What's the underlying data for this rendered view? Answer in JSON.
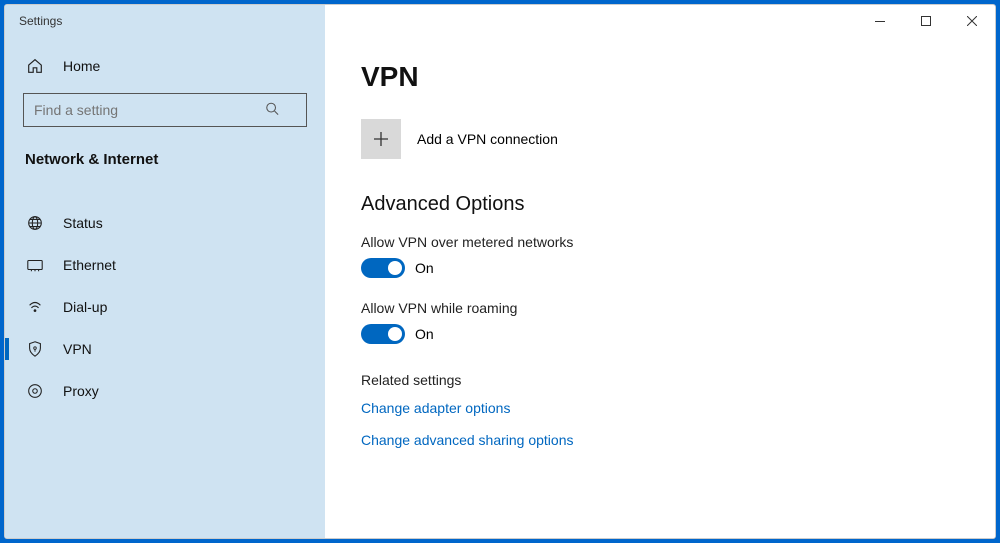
{
  "window": {
    "title": "Settings"
  },
  "sidebar": {
    "home_label": "Home",
    "search_placeholder": "Find a setting",
    "category_label": "Network & Internet",
    "items": [
      {
        "label": "Status"
      },
      {
        "label": "Ethernet"
      },
      {
        "label": "Dial-up"
      },
      {
        "label": "VPN"
      },
      {
        "label": "Proxy"
      }
    ]
  },
  "main": {
    "title": "VPN",
    "add_label": "Add a VPN connection",
    "advanced_title": "Advanced Options",
    "settings": [
      {
        "label": "Allow VPN over metered networks",
        "state": "On"
      },
      {
        "label": "Allow VPN while roaming",
        "state": "On"
      }
    ],
    "related_header": "Related settings",
    "links": [
      "Change adapter options",
      "Change advanced sharing options"
    ]
  }
}
